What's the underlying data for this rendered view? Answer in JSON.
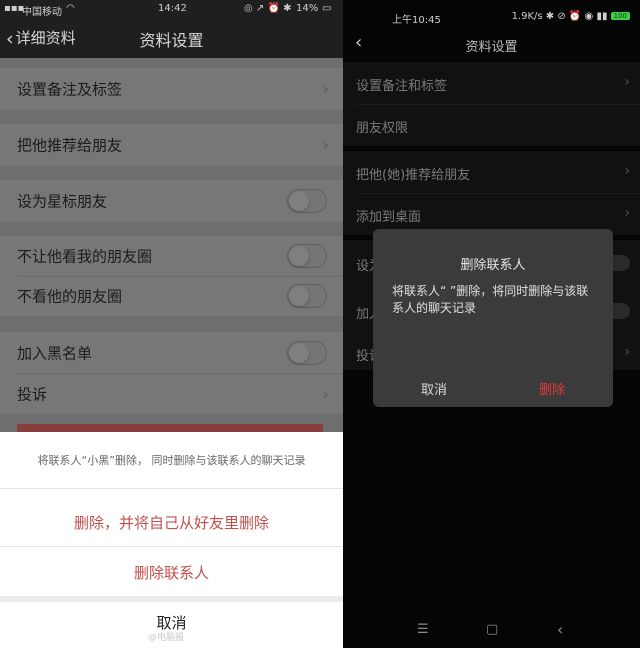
{
  "left": {
    "status": {
      "carrier": "中国移动",
      "time": "14:42",
      "battery": "14%"
    },
    "nav": {
      "back_label": "详细资料",
      "title": "资料设置"
    },
    "rows": {
      "remark": "设置备注及标签",
      "recommend": "把他推荐给朋友",
      "star": "设为星标朋友",
      "hide_my_moments": "不让他看我的朋友圈",
      "hide_his_moments": "不看他的朋友圈",
      "blacklist": "加入黑名单",
      "report": "投诉"
    },
    "sheet": {
      "message": "将联系人“小黑”删除， 同时删除与该联系人的聊天记录",
      "delete_and_remove": "删除，并将自己从好友里删除",
      "delete_contact": "删除联系人",
      "cancel": "取消",
      "watermark": "@电脑报"
    }
  },
  "right": {
    "status": {
      "time": "上午10:45",
      "speed": "1.9K/s",
      "battery": "100"
    },
    "nav": {
      "title": "资料设置"
    },
    "rows": {
      "remark": "设置备注和标签",
      "permission": "朋友权限",
      "recommend": "把他(她)推荐给朋友",
      "desktop": "添加到桌面",
      "star_partial": "设为",
      "blacklist_partial": "加入",
      "report_partial": "投诉"
    },
    "dialog": {
      "title": "删除联系人",
      "message": "将联系人“                    ”删除，将同时删除与该联系人的聊天记录",
      "cancel": "取消",
      "delete": "删除"
    },
    "navbar": {
      "menu": "☰",
      "home": "▢",
      "back": "‹"
    }
  },
  "colors": {
    "ios_danger": "#c0504c",
    "android_danger": "#e23b3b"
  }
}
